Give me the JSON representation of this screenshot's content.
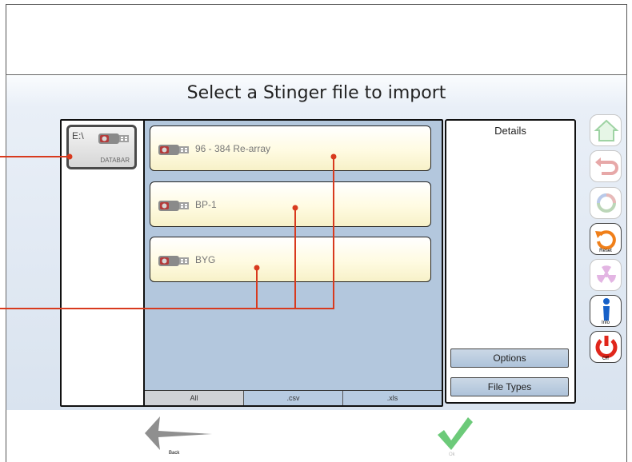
{
  "page_title": "Select a Stinger file to import",
  "drive": {
    "letter": "E:\\",
    "name": "DATABAR",
    "icon": "usb-drive-icon"
  },
  "files": [
    {
      "label": "96 - 384 Re-array",
      "icon": "usb-drive-icon"
    },
    {
      "label": "BP-1",
      "icon": "usb-drive-icon"
    },
    {
      "label": "BYG",
      "icon": "usb-drive-icon"
    }
  ],
  "filter_tabs": [
    "All",
    ".csv",
    ".xls"
  ],
  "details": {
    "title": "Details",
    "options_label": "Options",
    "file_types_label": "File Types"
  },
  "side_buttons": [
    {
      "id": "home",
      "label": "",
      "icon": "home-icon",
      "enabled": false
    },
    {
      "id": "undo",
      "label": "",
      "icon": "undo-icon",
      "enabled": false
    },
    {
      "id": "refresh",
      "label": "",
      "icon": "refresh-icon",
      "enabled": false
    },
    {
      "id": "reset",
      "label": "Reset",
      "icon": "reset-icon",
      "enabled": true
    },
    {
      "id": "radiation",
      "label": "",
      "icon": "radiation-icon",
      "enabled": false
    },
    {
      "id": "info",
      "label": "Info",
      "icon": "info-icon",
      "enabled": true
    },
    {
      "id": "off",
      "label": "Off",
      "icon": "power-icon",
      "enabled": true
    }
  ],
  "nav": {
    "back_label": "Back",
    "ok_label": "Ok"
  },
  "colors": {
    "panel_blue": "#b3c7dd",
    "file_item_yellow": "#fffbe2",
    "annotation_red": "#d83a1e",
    "ok_green": "#5cc46a",
    "power_red": "#e0261b",
    "info_blue": "#1660c8",
    "reset_orange": "#f07f19"
  }
}
